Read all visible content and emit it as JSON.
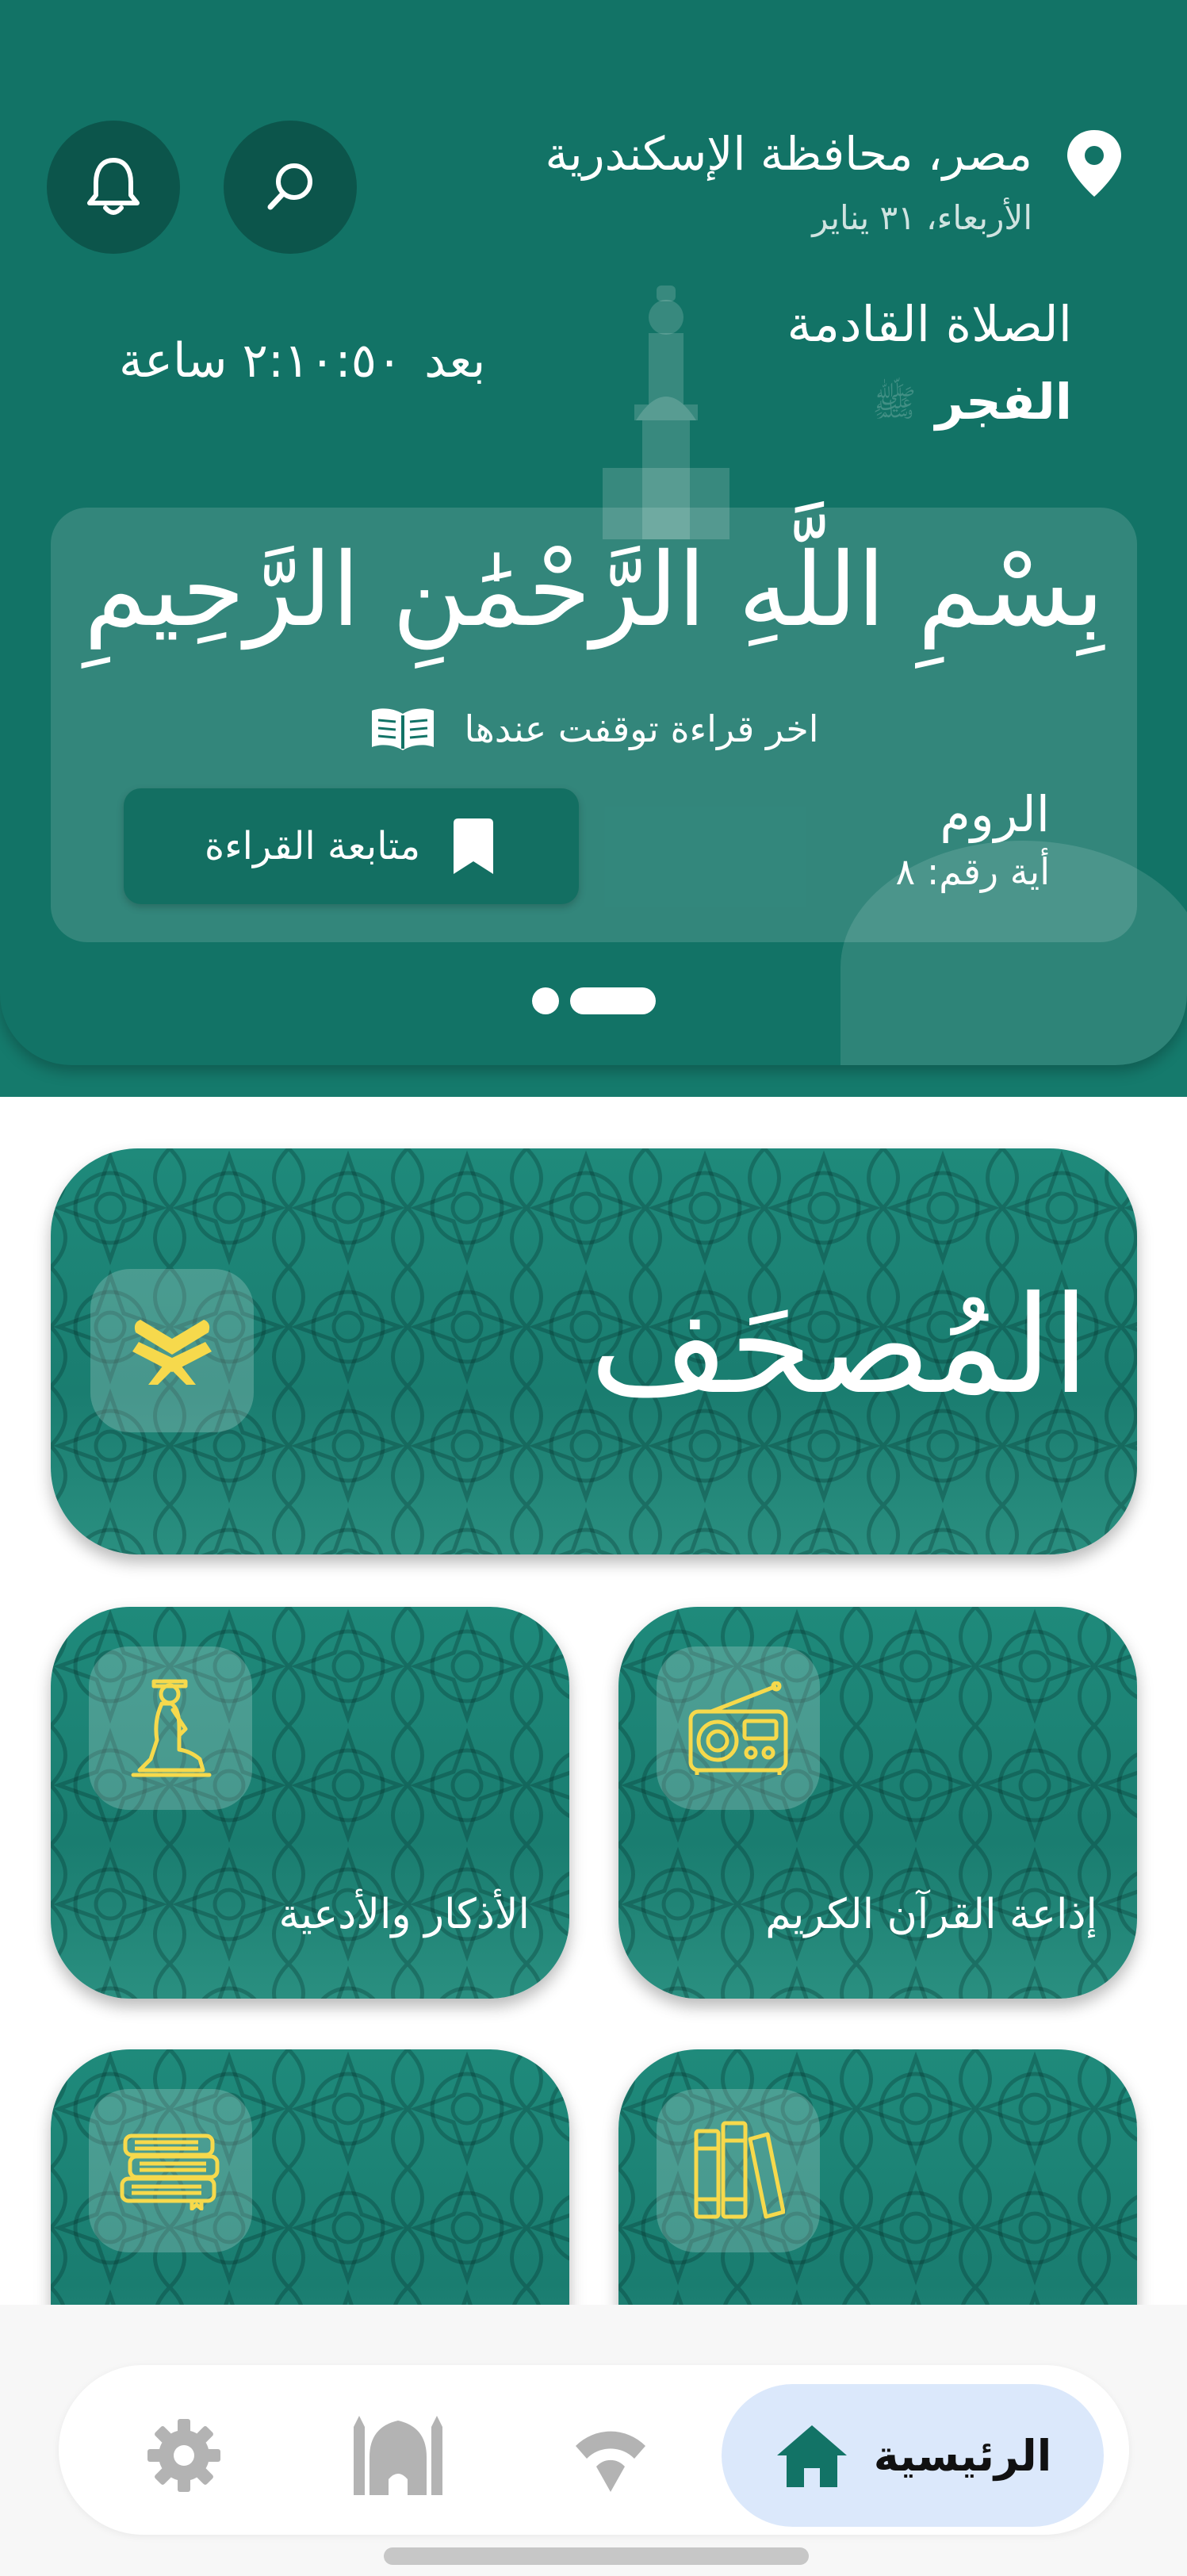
{
  "header": {
    "location": "مصر، محافظة الإسكندرية",
    "date": "الأربعاء، ٣١ يناير",
    "search_icon": "search-icon",
    "bell_icon": "bell-icon",
    "next_prayer_label": "الصلاة القادمة",
    "next_prayer_name": "الفجر",
    "countdown_prefix": "بعد",
    "countdown_value": "٢:١٠:٥٠ ساعة"
  },
  "last_read_card": {
    "basmala": "بِسْمِ اللَّهِ الرَّحْمَٰنِ الرَّحِيمِ",
    "label": "اخر قراءة توقفت عندها",
    "surah": "الروم",
    "ayah_label": "أية رقم:",
    "ayah_number": "٨",
    "continue_label": "متابعة القراءة"
  },
  "carousel": {
    "count": 2,
    "active_index": 0
  },
  "features": {
    "mushaf": "المُصحَف",
    "radio": "إذاعة القرآن الكريم",
    "athkar": "الأذكار والأدعية"
  },
  "bottom_nav": {
    "home_label": "الرئيسية",
    "items": [
      "home-icon",
      "radio-icon",
      "mosque-icon",
      "settings-icon"
    ]
  },
  "colors": {
    "primary": "#127366",
    "dark": "#0c554b",
    "accent_yellow": "#f6d94c",
    "nav_active_bg": "#dbe8fb"
  }
}
